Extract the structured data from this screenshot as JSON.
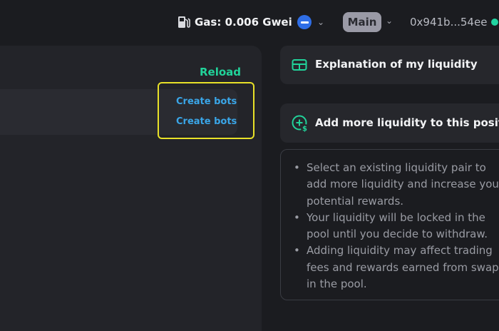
{
  "header": {
    "gas_label": "Gas: 0.006 Gwei",
    "network_label": "Main",
    "address": "0x941b...54ee"
  },
  "left": {
    "reload_label": "Reload",
    "create_bots": [
      "Create bots",
      "Create bots"
    ]
  },
  "right": {
    "card1_title": "Explanation of my liquidity",
    "card2_title": "Add more liquidity to this position",
    "bullets": [
      "Select an existing liquidity pair to add more liquidity and increase your potential rewards.",
      "Your liquidity will be locked in the pool until you decide to withdraw.",
      "Adding liquidity may affect trading fees and rewards earned from swaps in the pool."
    ]
  },
  "colors": {
    "accent_green": "#21d39a",
    "link_blue": "#3aa6e8",
    "highlight_yellow": "#e8e128",
    "status_dot": "#22d3a0"
  }
}
